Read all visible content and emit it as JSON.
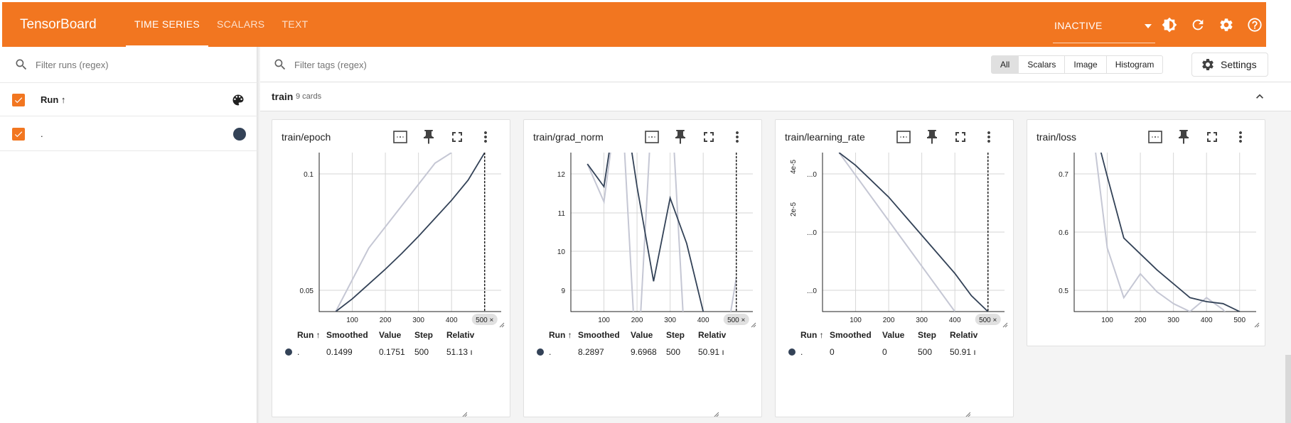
{
  "app": {
    "title": "TensorBoard",
    "accent": "#f27620"
  },
  "nav": {
    "tabs": [
      "TIME SERIES",
      "SCALARS",
      "TEXT"
    ],
    "active": "TIME SERIES"
  },
  "toolbar": {
    "status": "INACTIVE",
    "icons": [
      "theme-icon",
      "refresh-icon",
      "settings-icon",
      "help-icon"
    ]
  },
  "sidebar": {
    "search_placeholder": "Filter runs (regex)",
    "header": {
      "label": "Run ↑",
      "icon": "palette-icon"
    },
    "runs": [
      {
        "name": ".",
        "color": "#334257",
        "checked": true
      }
    ]
  },
  "filters": {
    "search_placeholder": "Filter tags (regex)",
    "types": [
      "All",
      "Scalars",
      "Image",
      "Histogram"
    ],
    "active_type": "All",
    "settings_label": "Settings"
  },
  "group": {
    "name": "train",
    "count": "9 cards"
  },
  "table_headers": [
    "Run ↑",
    "Smoothed",
    "Value",
    "Step",
    "Relativ"
  ],
  "cards": [
    {
      "title": "train/epoch",
      "y_ticks": [
        "0.1",
        "0.05"
      ],
      "x_ticks": [
        "100",
        "200",
        "300",
        "400"
      ],
      "step_badge": "500 ×",
      "row": {
        "run": ".",
        "smoothed": "0.1499",
        "value": "0.1751",
        "step": "500",
        "relative": "51.13 ı"
      }
    },
    {
      "title": "train/grad_norm",
      "y_ticks": [
        "12",
        "11",
        "10",
        "9"
      ],
      "x_ticks": [
        "100",
        "200",
        "300",
        "400"
      ],
      "step_badge": "500 ×",
      "row": {
        "run": ".",
        "smoothed": "8.2897",
        "value": "9.6968",
        "step": "500",
        "relative": "50.91 ı"
      }
    },
    {
      "title": "train/learning_rate",
      "y_ticks": [
        "...0",
        "...0",
        "...0"
      ],
      "y_side": [
        "4e-5",
        "2e-5"
      ],
      "x_ticks": [
        "100",
        "200",
        "300",
        "400"
      ],
      "step_badge": "500 ×",
      "row": {
        "run": ".",
        "smoothed": "0",
        "value": "0",
        "step": "500",
        "relative": "50.91 ı"
      }
    },
    {
      "title": "train/loss",
      "y_ticks": [
        "0.7",
        "0.6",
        "0.5"
      ],
      "x_ticks": [
        "100",
        "200",
        "300",
        "400",
        "500"
      ],
      "step_badge": "",
      "row": null
    }
  ],
  "chart_data": [
    {
      "type": "line",
      "title": "train/epoch",
      "xlim": [
        0,
        550
      ],
      "ylim": [
        0,
        0.15
      ],
      "series": [
        {
          "style": "raw",
          "x": [
            50,
            150,
            250,
            350,
            400
          ],
          "y": [
            0,
            0.06,
            0.1,
            0.14,
            0.15
          ]
        },
        {
          "style": "smoothed",
          "x": [
            50,
            100,
            150,
            200,
            250,
            300,
            350,
            400,
            450,
            500
          ],
          "y": [
            0,
            0.012,
            0.026,
            0.04,
            0.055,
            0.071,
            0.088,
            0.105,
            0.124,
            0.1499
          ]
        }
      ]
    },
    {
      "type": "line",
      "title": "train/grad_norm",
      "xlim": [
        0,
        550
      ],
      "ylim": [
        8.8,
        13
      ],
      "series": [
        {
          "style": "raw",
          "x": [
            50,
            100,
            150,
            200,
            250,
            300,
            350,
            400,
            450,
            500
          ],
          "y": [
            12.7,
            11.7,
            15,
            7,
            15,
            15,
            7,
            7,
            7,
            9.6968
          ]
        },
        {
          "style": "smoothed",
          "x": [
            50,
            100,
            150,
            200,
            250,
            300,
            350,
            400,
            450,
            500
          ],
          "y": [
            12.7,
            12.1,
            15,
            12.1,
            9.6,
            11.8,
            10.6,
            8.8,
            8.2,
            8.2897
          ]
        }
      ]
    },
    {
      "type": "line",
      "title": "train/learning_rate",
      "xlim": [
        0,
        550
      ],
      "ylim": [
        0,
        5e-05
      ],
      "series": [
        {
          "style": "raw",
          "x": [
            50,
            400
          ],
          "y": [
            5e-05,
            0
          ]
        },
        {
          "style": "smoothed",
          "x": [
            50,
            100,
            150,
            200,
            250,
            300,
            350,
            400,
            450,
            500
          ],
          "y": [
            5e-05,
            4.6e-05,
            4.1e-05,
            3.6e-05,
            3e-05,
            2.4e-05,
            1.8e-05,
            1.2e-05,
            5e-06,
            0
          ]
        }
      ]
    },
    {
      "type": "line",
      "title": "train/loss",
      "xlim": [
        0,
        550
      ],
      "ylim": [
        0.4,
        0.8
      ],
      "series": [
        {
          "style": "raw",
          "x": [
            50,
            100,
            150,
            200,
            250,
            300,
            350,
            400,
            450,
            500
          ],
          "y": [
            0.9,
            0.56,
            0.435,
            0.495,
            0.45,
            0.42,
            0.4,
            0.435,
            0.405,
            0.35
          ]
        },
        {
          "style": "smoothed",
          "x": [
            50,
            100,
            150,
            200,
            250,
            300,
            350,
            400,
            450,
            500
          ],
          "y": [
            0.9,
            0.74,
            0.585,
            0.545,
            0.505,
            0.47,
            0.435,
            0.425,
            0.42,
            0.4
          ]
        }
      ]
    }
  ]
}
